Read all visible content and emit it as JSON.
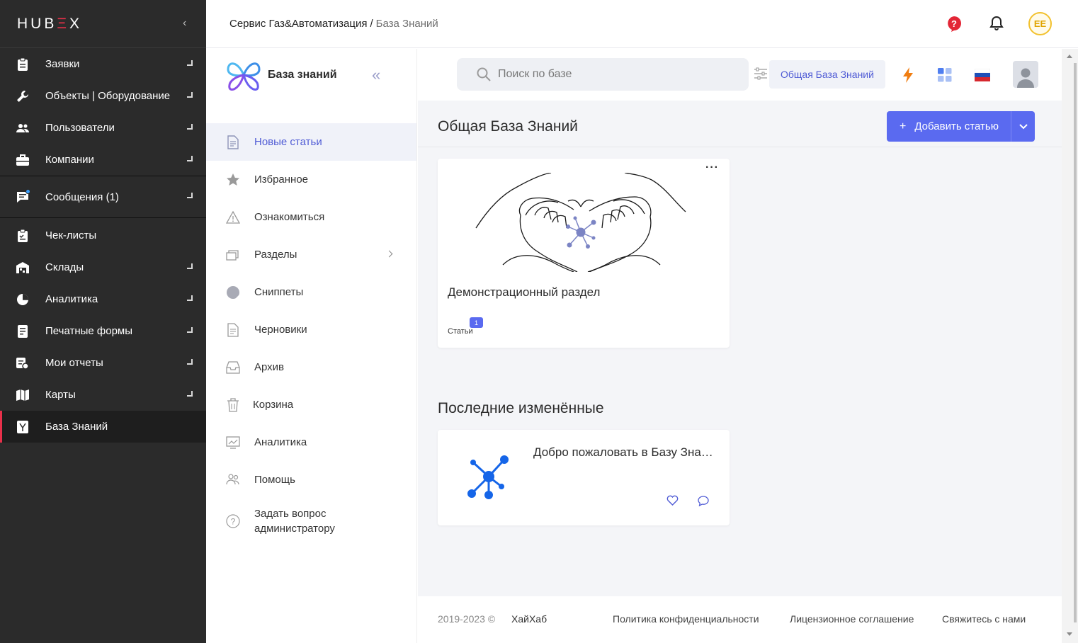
{
  "app": {
    "logo_text": "HUBEX",
    "logo_prefix": "HUB",
    "logo_e": "Ξ",
    "logo_suffix": "X"
  },
  "breadcrumb": {
    "org": "Сервис Газ&Автоматизация",
    "separator": "/",
    "current": "База Знаний"
  },
  "header": {
    "avatar_initials": "EE",
    "accent": "#e8304a"
  },
  "sidebar": {
    "items": [
      {
        "label": "Заявки",
        "icon": "clipboard-icon",
        "expandable": true
      },
      {
        "label": "Объекты | Оборудование",
        "icon": "wrench-icon",
        "expandable": true
      },
      {
        "label": "Пользователи",
        "icon": "users-icon",
        "expandable": true
      },
      {
        "label": "Компании",
        "icon": "briefcase-icon",
        "expandable": true
      },
      {
        "label": "Сообщения (1)",
        "icon": "chat-icon",
        "expandable": true
      },
      {
        "label": "Чек-листы",
        "icon": "checklist-icon",
        "expandable": false
      },
      {
        "label": "Склады",
        "icon": "warehouse-icon",
        "expandable": true
      },
      {
        "label": "Аналитика",
        "icon": "pie-chart-icon",
        "expandable": true
      },
      {
        "label": "Печатные формы",
        "icon": "print-form-icon",
        "expandable": true
      },
      {
        "label": "Мои отчеты",
        "icon": "report-icon",
        "expandable": true
      },
      {
        "label": "Карты",
        "icon": "map-icon",
        "expandable": true
      },
      {
        "label": "База Знаний",
        "icon": "knowledge-base-icon",
        "expandable": false,
        "active": true
      }
    ]
  },
  "kb": {
    "title": "База знаний",
    "menu": [
      {
        "label": "Новые статьи",
        "icon": "new-articles-icon",
        "active": true
      },
      {
        "label": "Избранное",
        "icon": "star-icon"
      },
      {
        "label": "Ознакомиться",
        "icon": "warning-icon"
      },
      {
        "label": "Разделы",
        "icon": "sections-icon",
        "has_children": true
      },
      {
        "label": "Сниппеты",
        "icon": "snippet-icon"
      },
      {
        "label": "Черновики",
        "icon": "draft-icon"
      },
      {
        "label": "Архив",
        "icon": "archive-icon"
      },
      {
        "label": "Корзина",
        "icon": "trash-icon"
      },
      {
        "label": "Аналитика",
        "icon": "analytics-icon"
      },
      {
        "label": "Помощь",
        "icon": "help-people-icon"
      },
      {
        "label_line1": "Задать вопрос",
        "label_line2": "администратору",
        "icon": "question-circle-icon"
      }
    ]
  },
  "toolbar": {
    "search_placeholder": "Поиск по базе",
    "kb_chip": "Общая База Знаний"
  },
  "main": {
    "title": "Общая База Знаний",
    "add_button": "Добавить статью",
    "add_plus": "+",
    "section_card": {
      "title": "Демонстрационный раздел",
      "meta_label": "Статьи",
      "meta_count": "1",
      "more": "···"
    },
    "recent_title": "Последние изменённые",
    "recent_article": {
      "title": "Добро пожаловать в Базу Знаний"
    }
  },
  "footer": {
    "copyright": "2019-2023 ©",
    "brand": "ХайХаб",
    "privacy": "Политика конфиденциальности",
    "license": "Лицензионное соглашение",
    "contact": "Свяжитесь с нами"
  }
}
